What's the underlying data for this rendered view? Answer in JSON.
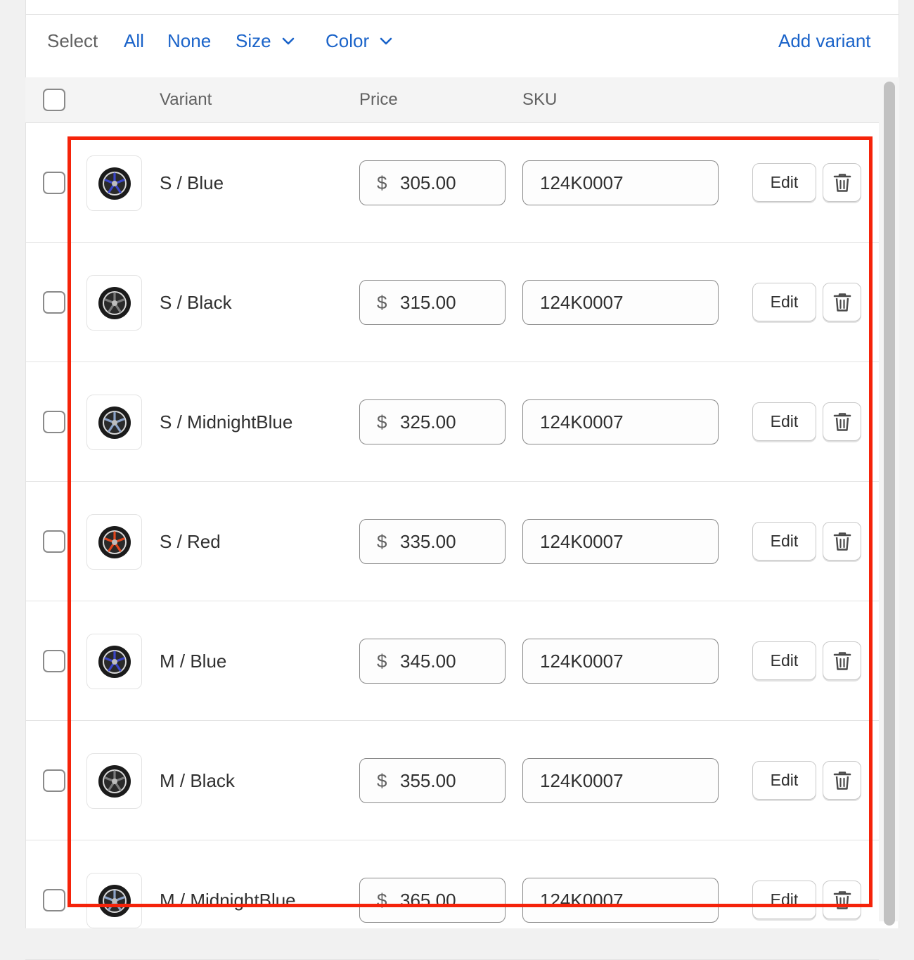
{
  "toolbar": {
    "select_label": "Select",
    "all_label": "All",
    "none_label": "None",
    "size_label": "Size",
    "color_label": "Color",
    "add_variant_label": "Add variant"
  },
  "table_header": {
    "variant": "Variant",
    "price": "Price",
    "sku": "SKU"
  },
  "edit_label": "Edit",
  "currency_symbol": "$",
  "icons": {
    "chevron": "chevron-down-icon",
    "delete": "trash-icon",
    "thumbnail": "wheel-image"
  },
  "colors": {
    "link": "#1a63c9",
    "highlight": "#f5230a"
  },
  "variants": [
    {
      "name": "S / Blue",
      "price": "305.00",
      "sku": "124K0007",
      "accent": "#3a46c8"
    },
    {
      "name": "S / Black",
      "price": "315.00",
      "sku": "124K0007",
      "accent": "#7a7a7a"
    },
    {
      "name": "S / MidnightBlue",
      "price": "325.00",
      "sku": "124K0007",
      "accent": "#8aa2c8"
    },
    {
      "name": "S / Red",
      "price": "335.00",
      "sku": "124K0007",
      "accent": "#e2461c"
    },
    {
      "name": "M / Blue",
      "price": "345.00",
      "sku": "124K0007",
      "accent": "#3a46c8"
    },
    {
      "name": "M / Black",
      "price": "355.00",
      "sku": "124K0007",
      "accent": "#7a7a7a"
    },
    {
      "name": "M / MidnightBlue",
      "price": "365.00",
      "sku": "124K0007",
      "accent": "#8aa2c8"
    }
  ]
}
